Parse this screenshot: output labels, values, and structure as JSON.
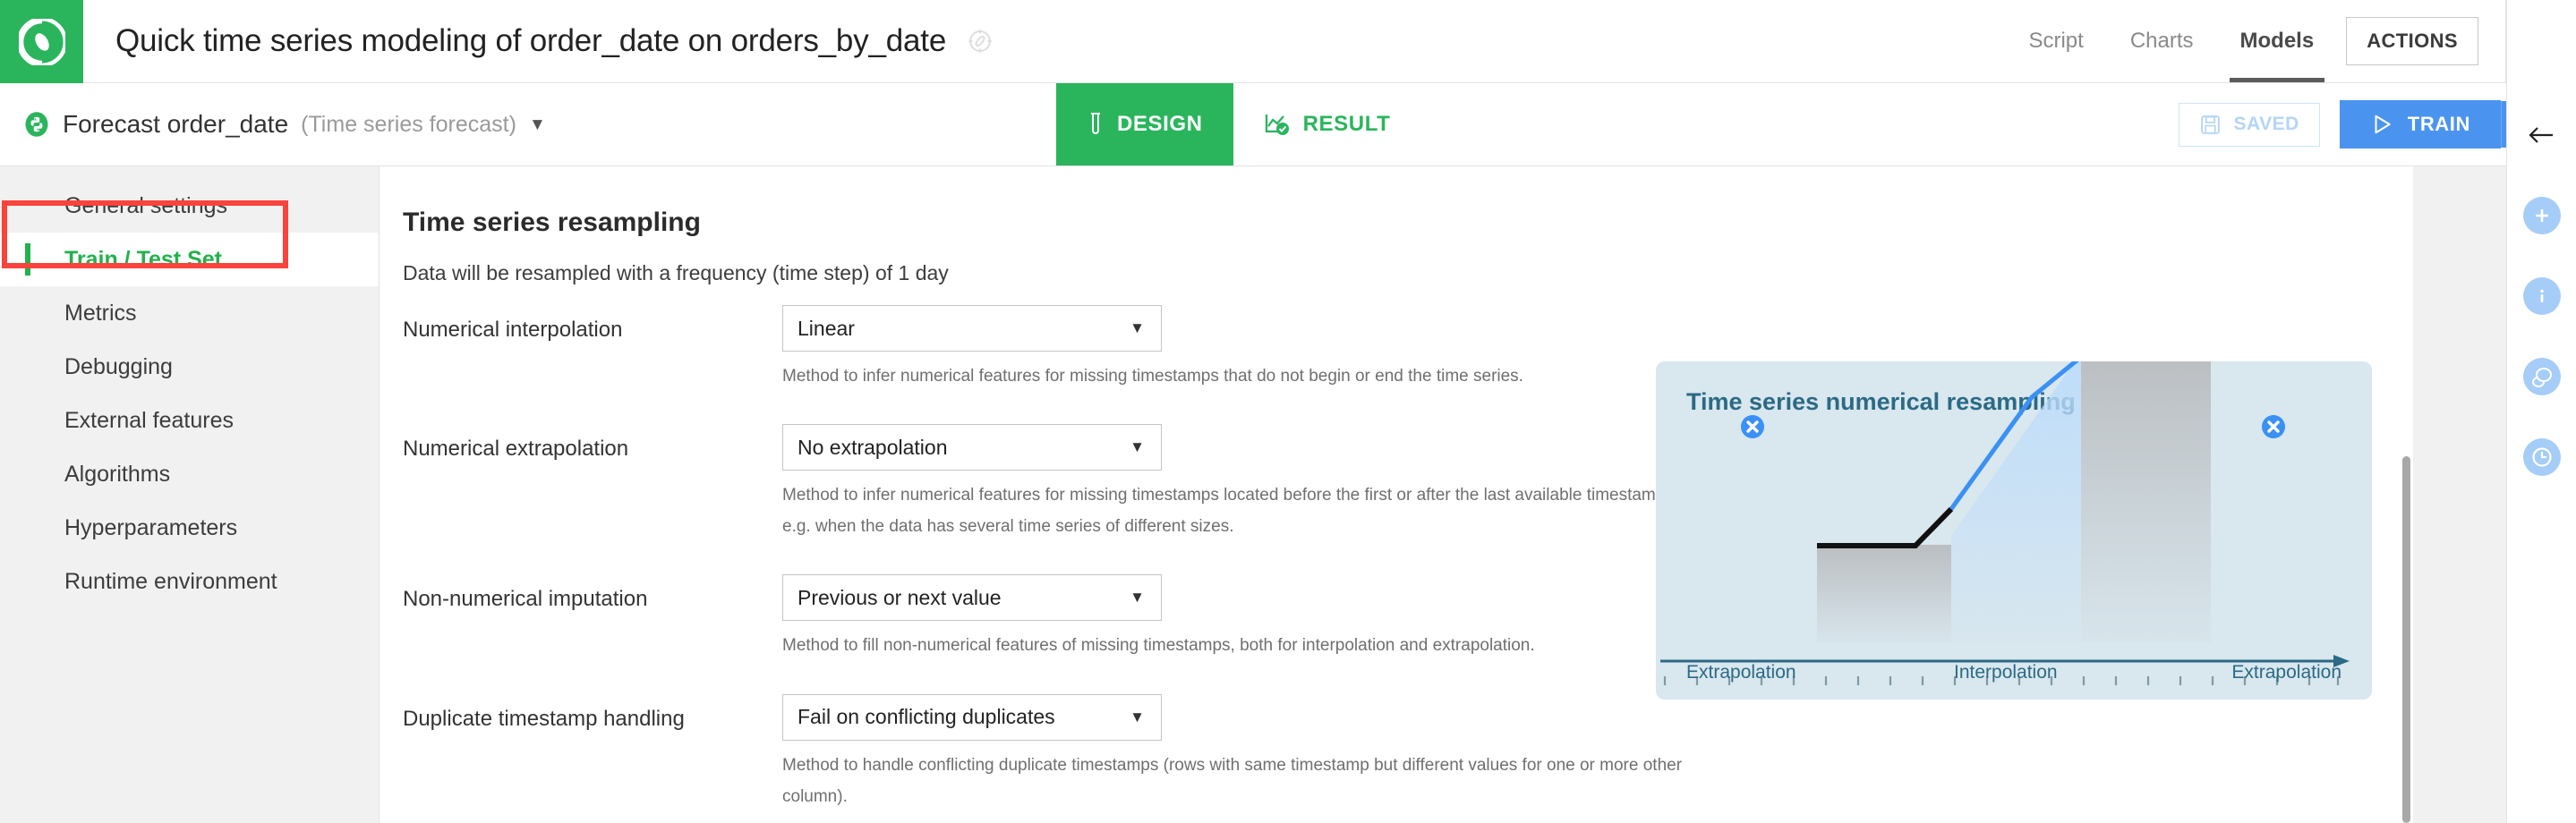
{
  "header": {
    "logo_icon": "dataiku-logo-icon",
    "title": "Quick time series modeling of order_date on orders_by_date",
    "compass_icon": "compass-icon",
    "nav": [
      {
        "label": "Script",
        "active": false
      },
      {
        "label": "Charts",
        "active": false
      },
      {
        "label": "Models",
        "active": true
      }
    ],
    "actions_label": "ACTIONS",
    "back_icon": "back-arrow-icon"
  },
  "subbar": {
    "python_icon": "python-recipe-icon",
    "forecast_name": "Forecast order_date",
    "forecast_type": "(Time series forecast)",
    "dropdown_caret": "▼",
    "tabs": [
      {
        "label": "DESIGN",
        "icon": "test-tube-icon",
        "active": true
      },
      {
        "label": "RESULT",
        "icon": "result-check-icon",
        "active": false
      }
    ],
    "saved_label": "SAVED",
    "saved_icon": "floppy-disk-icon",
    "train_label": "TRAIN",
    "train_icon": "play-triangle-icon",
    "train_caret_icon": "chevron-down-icon"
  },
  "sidebar": {
    "items": [
      {
        "label": "General settings",
        "active": false
      },
      {
        "label": "Train / Test Set",
        "active": true
      },
      {
        "label": "Metrics",
        "active": false
      },
      {
        "label": "Debugging",
        "active": false
      },
      {
        "label": "External features",
        "active": false
      },
      {
        "label": "Algorithms",
        "active": false
      },
      {
        "label": "Hyperparameters",
        "active": false
      },
      {
        "label": "Runtime environment",
        "active": false
      }
    ],
    "annotation": "red-highlight-box"
  },
  "main": {
    "section_title": "Time series resampling",
    "section_desc": "Data will be resampled with a frequency (time step) of 1 day",
    "fields": [
      {
        "label": "Numerical interpolation",
        "value": "Linear",
        "help": "Method to infer numerical features for missing timestamps that do not begin or end the time series."
      },
      {
        "label": "Numerical extrapolation",
        "value": "No extrapolation",
        "help": "Method to infer numerical features for missing timestamps located before the first or after the last available timestamp, e.g. when the data has several time series of different sizes."
      },
      {
        "label": "Non-numerical imputation",
        "value": "Previous or next value",
        "help": "Method to fill non-numerical features of missing timestamps, both for interpolation and extrapolation."
      },
      {
        "label": "Duplicate timestamp handling",
        "value": "Fail on conflicting duplicates",
        "help": "Method to handle conflicting duplicate timestamps (rows with same timestamp but different values for one or more other column)."
      }
    ]
  },
  "illustration": {
    "title": "Time series numerical resampling",
    "labels": {
      "left": "Extrapolation",
      "middle": "Interpolation",
      "right": "Extrapolation"
    },
    "marker_icon": "x-circle-marker-icon",
    "axis_arrow_icon": "right-arrow-axis-icon",
    "colors": {
      "panel_bg": "#d9e7ee",
      "accent_blue": "#3b90f5",
      "axis": "#2b6a85",
      "known_line": "#111111"
    }
  },
  "rail": {
    "icons": [
      {
        "name": "back-arrow-icon",
        "glyph": "←"
      },
      {
        "name": "plus-icon",
        "glyph": "+"
      },
      {
        "name": "info-icon",
        "glyph": "i"
      },
      {
        "name": "discussion-icon",
        "glyph": "◯"
      },
      {
        "name": "history-clock-icon",
        "glyph": "◯"
      }
    ]
  },
  "scrollbar": {
    "name": "content-vertical-scrollbar"
  }
}
